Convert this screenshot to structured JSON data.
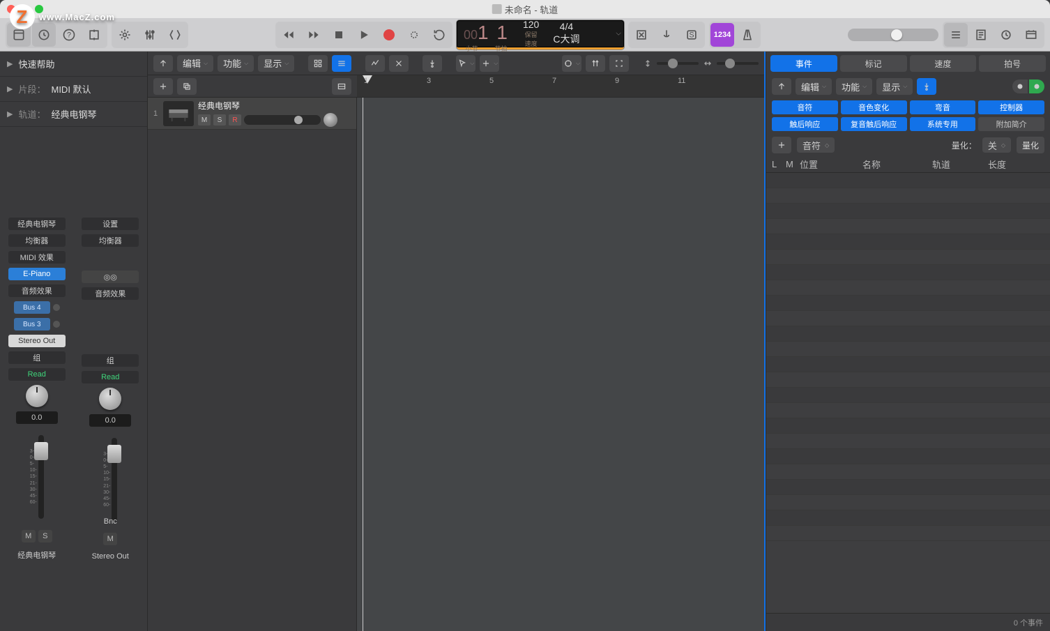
{
  "window": {
    "title": "未命名 - 轨道"
  },
  "lcd": {
    "bars_prefix": "00",
    "bars": "1 1",
    "bars_lbl1": "小节",
    "bars_lbl2": "节拍",
    "tempo": "120",
    "tempo_lbl": "保留",
    "tempo_sub": "速度",
    "sig": "4/4",
    "key": "C大调"
  },
  "purple_btn": "1234",
  "left": {
    "quick_help": "快速帮助",
    "region_lbl": "片段：",
    "region_val": "MIDI 默认",
    "track_lbl": "轨道：",
    "track_val": "经典电钢琴"
  },
  "chan1": {
    "name": "经典电钢琴",
    "eq": "均衡器",
    "midifx": "MIDI 效果",
    "inst": "E-Piano",
    "audiofx": "音频效果",
    "bus1": "Bus 4",
    "bus2": "Bus 3",
    "out": "Stereo Out",
    "group": "组",
    "auto": "Read",
    "db": "0.0",
    "m": "M",
    "s": "S",
    "label": "经典电钢琴"
  },
  "chan2": {
    "name": "设置",
    "eq": "均衡器",
    "audiofx": "音频效果",
    "group": "组",
    "auto": "Read",
    "db": "0.0",
    "bnc": "Bnc",
    "m": "M",
    "label": "Stereo Out"
  },
  "tracks_tb": {
    "edit": "编辑",
    "func": "功能",
    "view": "显示"
  },
  "ruler": [
    "1",
    "3",
    "5",
    "7",
    "9",
    "11"
  ],
  "track1": {
    "num": "1",
    "name": "经典电钢琴",
    "m": "M",
    "s": "S",
    "r": "R"
  },
  "right": {
    "tabs": [
      "事件",
      "标记",
      "速度",
      "拍号"
    ],
    "tb": {
      "edit": "编辑",
      "func": "功能",
      "view": "显示"
    },
    "filters_on": [
      "音符",
      "音色变化",
      "弯音",
      "控制器",
      "触后响应",
      "复音触后响应",
      "系统专用"
    ],
    "filters_off": [
      "附加简介"
    ],
    "add_type": "音符",
    "quant_lbl": "量化：",
    "quant_val": "关",
    "quant_btn": "量化",
    "cols": [
      "L",
      "M",
      "位置",
      "名称",
      "轨道",
      "长度"
    ],
    "status": "0 个事件"
  }
}
